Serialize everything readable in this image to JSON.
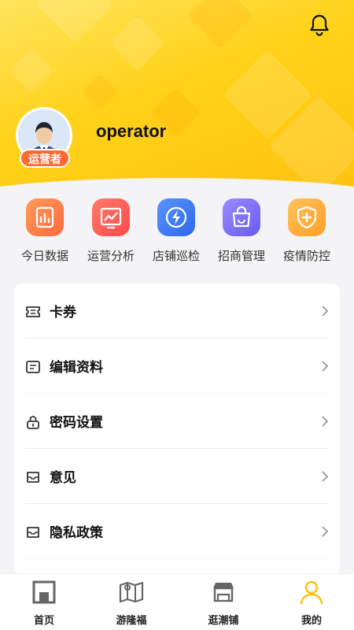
{
  "header": {
    "username": "operator",
    "role_badge": "运营者"
  },
  "quick_actions": [
    {
      "label": "今日数据",
      "icon": "chart-bar-icon",
      "color": "#ff7a45"
    },
    {
      "label": "运营分析",
      "icon": "trend-analysis-icon",
      "color": "#ff5c5c"
    },
    {
      "label": "店铺巡检",
      "icon": "lightning-icon",
      "color": "#3a7bf0"
    },
    {
      "label": "招商管理",
      "icon": "shopping-bag-icon",
      "color": "#7b6cf6"
    },
    {
      "label": "疫情防控",
      "icon": "shield-plus-icon",
      "color": "#ffb03a"
    }
  ],
  "menu": [
    {
      "label": "卡券",
      "icon": "ticket-icon"
    },
    {
      "label": "编辑资料",
      "icon": "edit-profile-icon"
    },
    {
      "label": "密码设置",
      "icon": "lock-icon"
    },
    {
      "label": "意见",
      "icon": "feedback-icon"
    },
    {
      "label": "隐私政策",
      "icon": "privacy-icon"
    }
  ],
  "tabbar": [
    {
      "label": "首页",
      "icon": "home-icon",
      "active": false
    },
    {
      "label": "游隆福",
      "icon": "map-icon",
      "active": false
    },
    {
      "label": "逛潮铺",
      "icon": "store-icon",
      "active": false
    },
    {
      "label": "我的",
      "icon": "user-icon",
      "active": true
    }
  ],
  "colors": {
    "brand_yellow": "#ffd21a",
    "active_tab": "#ffc20e",
    "badge": "#ff6a33"
  }
}
